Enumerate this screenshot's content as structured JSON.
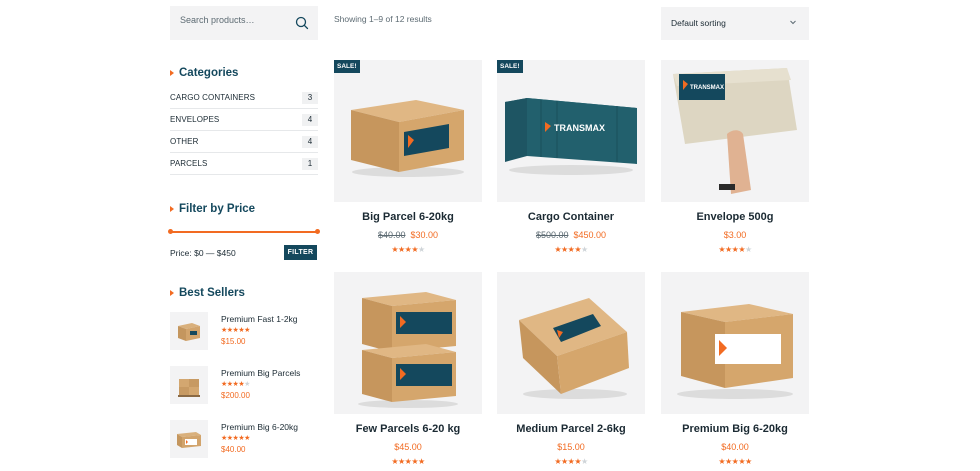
{
  "search": {
    "placeholder": "Search products…",
    "icon": "magnifier"
  },
  "results": {
    "text": "Showing 1–9 of 12 results"
  },
  "sort": {
    "selected": "Default sorting"
  },
  "categories": {
    "title": "Categories",
    "items": [
      {
        "name": "CARGO CONTAINERS",
        "count": "3"
      },
      {
        "name": "ENVELOPES",
        "count": "4"
      },
      {
        "name": "OTHER",
        "count": "4"
      },
      {
        "name": "PARCELS",
        "count": "1"
      }
    ]
  },
  "price_filter": {
    "title": "Filter by Price",
    "label": "Price: $0 — $450",
    "button": "FILTER",
    "min": 0,
    "max": 450
  },
  "best_sellers": {
    "title": "Best Sellers",
    "items": [
      {
        "name": "Premium Fast 1-2kg",
        "price": "$15.00",
        "rating": 4.5
      },
      {
        "name": "Premium Big Parcels",
        "price": "$200.00",
        "rating": 4
      },
      {
        "name": "Premium Big 6-20kg",
        "price": "$40.00",
        "rating": 4.5
      }
    ]
  },
  "products": [
    {
      "title": "Big Parcel 6-20kg",
      "old_price": "$40.00",
      "price": "$30.00",
      "sale": "SALE!",
      "rating": 4,
      "kind": "box"
    },
    {
      "title": "Cargo Container",
      "old_price": "$500.00",
      "price": "$450.00",
      "sale": "SALE!",
      "rating": 4,
      "kind": "container"
    },
    {
      "title": "Envelope 500g",
      "old_price": "",
      "price": "$3.00",
      "sale": "",
      "rating": 4,
      "kind": "envelope"
    },
    {
      "title": "Few Parcels 6-20 kg",
      "old_price": "",
      "price": "$45.00",
      "sale": "",
      "rating": 5,
      "kind": "stack"
    },
    {
      "title": "Medium Parcel 2-6kg",
      "old_price": "",
      "price": "$15.00",
      "sale": "",
      "rating": 4,
      "kind": "tilted"
    },
    {
      "title": "Premium Big 6-20kg",
      "old_price": "",
      "price": "$40.00",
      "sale": "",
      "rating": 4.5,
      "kind": "premium"
    }
  ],
  "brand": {
    "logo_text": "TRANSMAX"
  },
  "colors": {
    "accent": "#f26b22",
    "primary": "#14485d",
    "tile": "#f3f3f4"
  }
}
